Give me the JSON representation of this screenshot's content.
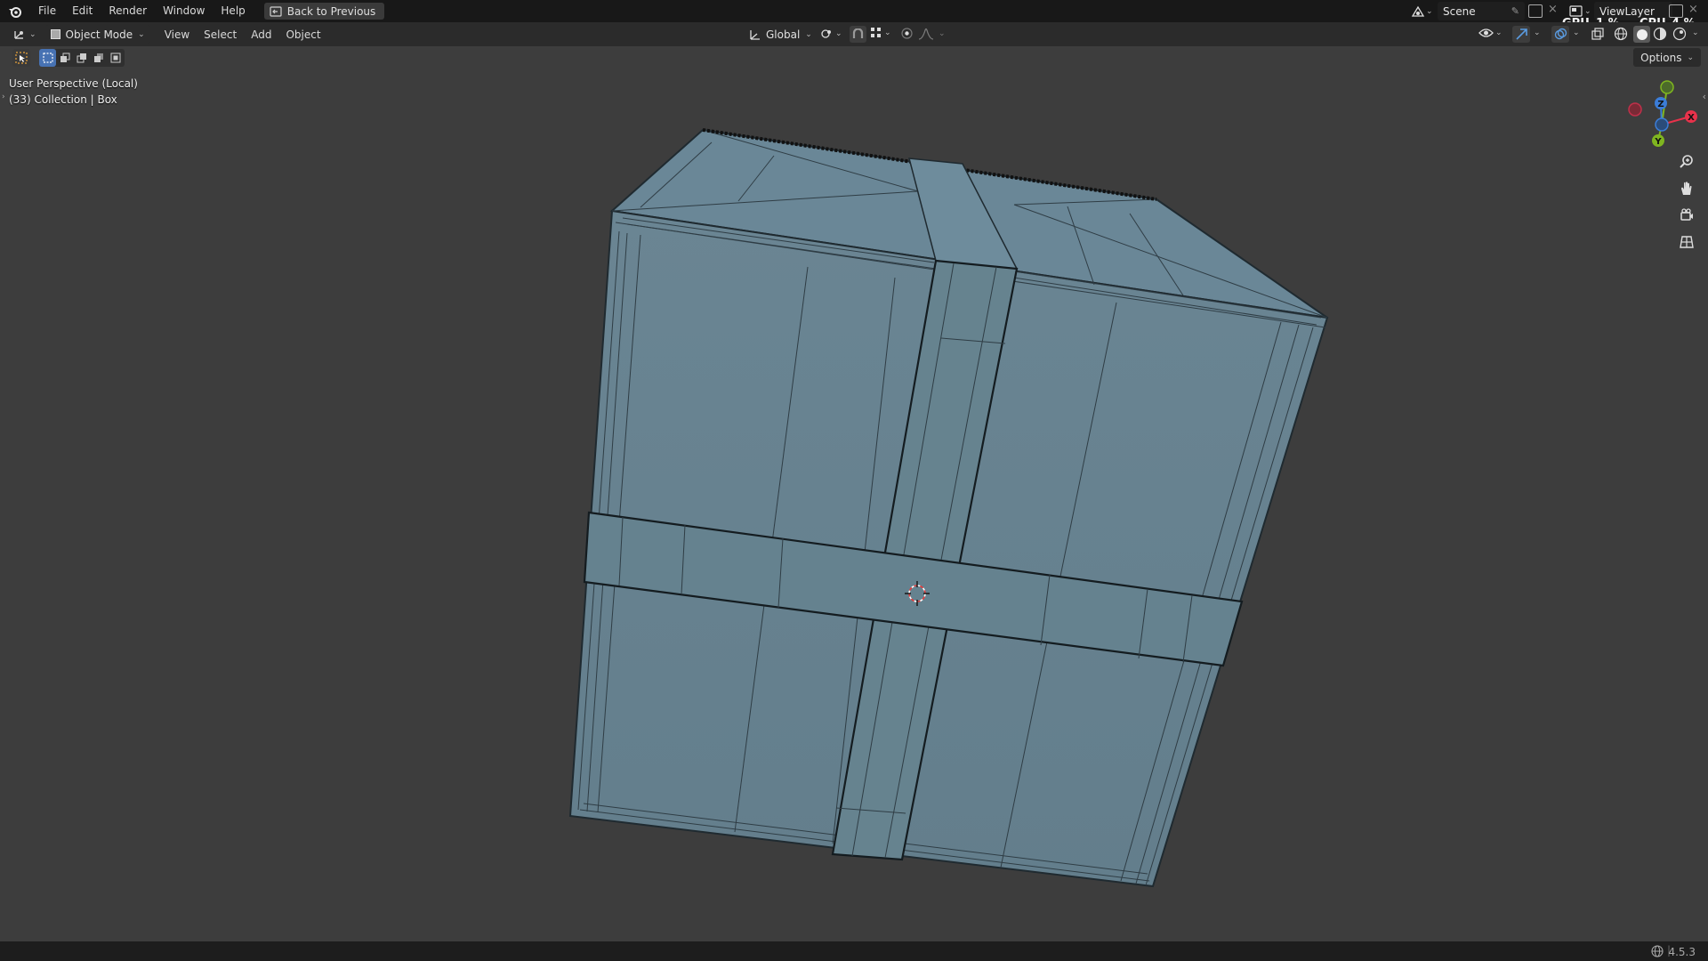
{
  "menu": {
    "items": [
      "File",
      "Edit",
      "Render",
      "Window",
      "Help"
    ],
    "back_label": "Back to Previous"
  },
  "topright": {
    "scene_label": "Scene",
    "viewlayer_label": "ViewLayer",
    "gpu_label": "GPU",
    "gpu_value": "1 %",
    "cpu_label": "CPU",
    "cpu_value": "4 %"
  },
  "header": {
    "mode_label": "Object Mode",
    "menus": [
      "View",
      "Select",
      "Add",
      "Object"
    ],
    "orientation_label": "Global",
    "options_label": "Options"
  },
  "viewport": {
    "view_name": "User Perspective (Local)",
    "collection_info": "(33) Collection | Box",
    "object_color": "#64818f",
    "axes": {
      "x": "X",
      "y": "Y",
      "z": "Z"
    }
  },
  "status": {
    "version": "4.5.3"
  },
  "colors": {
    "background": "#3d3d3d",
    "topbar": "#181818",
    "header": "#2b2b2b",
    "axis_x": "#e8324b",
    "axis_y": "#7fb520",
    "axis_z": "#3b7dd8"
  }
}
